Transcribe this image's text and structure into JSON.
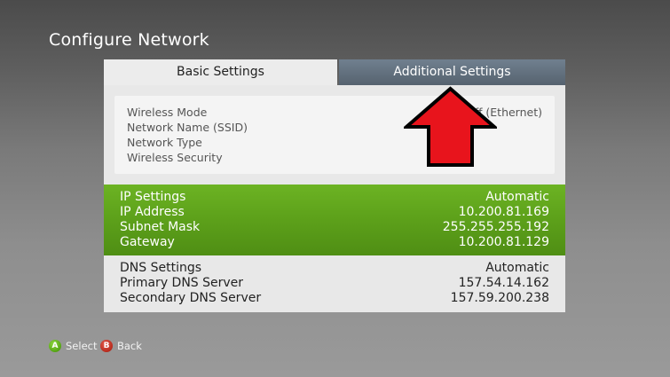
{
  "page": {
    "title": "Configure Network"
  },
  "tabs": [
    {
      "label": "Basic Settings"
    },
    {
      "label": "Additional Settings"
    }
  ],
  "wireless": {
    "rows": [
      {
        "label": "Wireless Mode",
        "value": "ff (Ethernet)"
      },
      {
        "label": "Network Name (SSID)",
        "value": ""
      },
      {
        "label": "Network Type",
        "value": ""
      },
      {
        "label": "Wireless Security",
        "value": ""
      }
    ]
  },
  "ip": {
    "rows": [
      {
        "label": "IP Settings",
        "value": "Automatic"
      },
      {
        "label": "IP Address",
        "value": "10.200.81.169"
      },
      {
        "label": "Subnet Mask",
        "value": "255.255.255.192"
      },
      {
        "label": "Gateway",
        "value": "10.200.81.129"
      }
    ]
  },
  "dns": {
    "rows": [
      {
        "label": "DNS Settings",
        "value": "Automatic"
      },
      {
        "label": "Primary DNS Server",
        "value": "157.54.14.162"
      },
      {
        "label": "Secondary DNS Server",
        "value": "157.59.200.238"
      }
    ]
  },
  "hints": {
    "select_glyph": "A",
    "select_label": "Select",
    "back_glyph": "B",
    "back_label": "Back"
  },
  "colors": {
    "accent_green": "#5ea21b",
    "tab_inactive": "#5f6c78",
    "annotation_arrow": "#e8141c"
  },
  "icons": {
    "annotation": "red-up-arrow-icon",
    "select_button": "a-button-icon",
    "back_button": "b-button-icon"
  }
}
